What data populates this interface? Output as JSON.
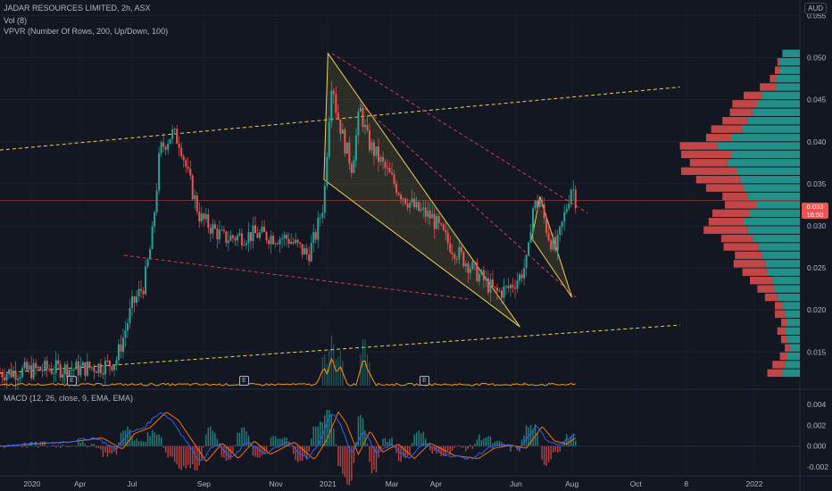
{
  "header": {
    "title": "JADAR RESOURCES LIMITED, 2h, ASX",
    "vol_label": "Vol (8)",
    "vpvr_label": "VPVR (Number Of Rows, 200, Up/Down, 100)",
    "currency": "AUD"
  },
  "macd": {
    "label": "MACD (12, 26, close, 9, EMA, EMA)"
  },
  "last_price": {
    "value": "0.033",
    "countdown": "16:50",
    "color": "#ef5350"
  },
  "events": [
    "E",
    "E",
    "E"
  ],
  "colors": {
    "up": "#26a69a",
    "down": "#ef5350",
    "macd": "#2962ff",
    "signal": "#ff6d00",
    "trend_yellow": "#f0d050",
    "trend_red": "#d04050",
    "volume_line": "#ff9800"
  },
  "chart_data": {
    "type": "candlestick",
    "title": "JADAR RESOURCES LIMITED, 2h, ASX",
    "y_axis": {
      "ylim": [
        0.011,
        0.056
      ],
      "ticks": [
        "0.055",
        "0.050",
        "0.045",
        "0.040",
        "0.035",
        "0.030",
        "0.025",
        "0.020",
        "0.015"
      ]
    },
    "x_axis": {
      "ticks": [
        "2020",
        "Apr",
        "Jul",
        "Sep",
        "Nov",
        "2021",
        "Mar",
        "Apr",
        "Jun",
        "Aug",
        "Oct",
        "8",
        "2022"
      ]
    },
    "price_path": [
      [
        0,
        0.0125
      ],
      [
        0.06,
        0.013
      ],
      [
        0.1,
        0.013
      ],
      [
        0.135,
        0.0135
      ],
      [
        0.145,
        0.014
      ],
      [
        0.155,
        0.017
      ],
      [
        0.165,
        0.0205
      ],
      [
        0.18,
        0.023
      ],
      [
        0.19,
        0.0285
      ],
      [
        0.2,
        0.039
      ],
      [
        0.215,
        0.041
      ],
      [
        0.225,
        0.04
      ],
      [
        0.235,
        0.036
      ],
      [
        0.25,
        0.031
      ],
      [
        0.28,
        0.0285
      ],
      [
        0.32,
        0.029
      ],
      [
        0.36,
        0.0285
      ],
      [
        0.385,
        0.0265
      ],
      [
        0.395,
        0.029
      ],
      [
        0.405,
        0.033
      ],
      [
        0.41,
        0.041
      ],
      [
        0.415,
        0.048
      ],
      [
        0.42,
        0.044
      ],
      [
        0.43,
        0.04
      ],
      [
        0.44,
        0.037
      ],
      [
        0.45,
        0.044
      ],
      [
        0.46,
        0.04
      ],
      [
        0.48,
        0.037
      ],
      [
        0.5,
        0.034
      ],
      [
        0.52,
        0.032
      ],
      [
        0.54,
        0.031
      ],
      [
        0.56,
        0.028
      ],
      [
        0.58,
        0.026
      ],
      [
        0.6,
        0.024
      ],
      [
        0.62,
        0.022
      ],
      [
        0.635,
        0.0225
      ],
      [
        0.65,
        0.024
      ],
      [
        0.66,
        0.026
      ],
      [
        0.665,
        0.032
      ],
      [
        0.675,
        0.033
      ],
      [
        0.685,
        0.029
      ],
      [
        0.695,
        0.027
      ],
      [
        0.705,
        0.031
      ],
      [
        0.71,
        0.033
      ],
      [
        0.715,
        0.035
      ],
      [
        0.72,
        0.033
      ]
    ],
    "last_value": 0.033,
    "trendlines": [
      {
        "color": "#f0d050",
        "dash": true,
        "points": [
          [
            0,
            0.039
          ],
          [
            0.85,
            0.0465
          ]
        ]
      },
      {
        "color": "#f0d050",
        "dash": true,
        "points": [
          [
            0,
            0.0125
          ],
          [
            0.85,
            0.0182
          ]
        ]
      },
      {
        "color": "#d04050",
        "dash": true,
        "points": [
          [
            0.155,
            0.0265
          ],
          [
            0.585,
            0.0213
          ]
        ]
      },
      {
        "color": "#d04050",
        "dash": true,
        "points": [
          [
            0.415,
            0.0505
          ],
          [
            0.735,
            0.0315
          ]
        ]
      },
      {
        "color": "#d04050",
        "dash": true,
        "points": [
          [
            0.45,
            0.0445
          ],
          [
            0.72,
            0.0215
          ]
        ]
      }
    ],
    "wedges": [
      {
        "points": [
          [
            0.405,
            0.0355
          ],
          [
            0.41,
            0.0505
          ],
          [
            0.65,
            0.018
          ]
        ]
      },
      {
        "points": [
          [
            0.665,
            0.0285
          ],
          [
            0.675,
            0.0335
          ],
          [
            0.715,
            0.0215
          ]
        ]
      }
    ],
    "horizontal_line": {
      "value": 0.033,
      "color": "#ef5350"
    },
    "volume_profile": {
      "rows": [
        [
          0.0505,
          0.14,
          0.0
        ],
        [
          0.0495,
          0.16,
          0.02
        ],
        [
          0.0485,
          0.16,
          0.04
        ],
        [
          0.0475,
          0.19,
          0.05
        ],
        [
          0.0465,
          0.19,
          0.13
        ],
        [
          0.0455,
          0.3,
          0.15
        ],
        [
          0.0445,
          0.34,
          0.2
        ],
        [
          0.0435,
          0.38,
          0.18
        ],
        [
          0.0425,
          0.42,
          0.2
        ],
        [
          0.0415,
          0.46,
          0.25
        ],
        [
          0.0405,
          0.55,
          0.2
        ],
        [
          0.0395,
          0.66,
          0.3
        ],
        [
          0.0385,
          0.55,
          0.4
        ],
        [
          0.0375,
          0.58,
          0.3
        ],
        [
          0.0365,
          0.5,
          0.45
        ],
        [
          0.0355,
          0.48,
          0.35
        ],
        [
          0.0345,
          0.45,
          0.3
        ],
        [
          0.0335,
          0.42,
          0.2
        ],
        [
          0.0325,
          0.35,
          0.25
        ],
        [
          0.0315,
          0.4,
          0.3
        ],
        [
          0.0305,
          0.45,
          0.28
        ],
        [
          0.0295,
          0.42,
          0.35
        ],
        [
          0.0285,
          0.38,
          0.25
        ],
        [
          0.0275,
          0.33,
          0.28
        ],
        [
          0.0265,
          0.3,
          0.22
        ],
        [
          0.0255,
          0.28,
          0.25
        ],
        [
          0.0245,
          0.26,
          0.2
        ],
        [
          0.0235,
          0.22,
          0.18
        ],
        [
          0.0225,
          0.2,
          0.14
        ],
        [
          0.0215,
          0.18,
          0.1
        ],
        [
          0.0205,
          0.14,
          0.06
        ],
        [
          0.0195,
          0.12,
          0.08
        ],
        [
          0.0185,
          0.1,
          0.05
        ],
        [
          0.0175,
          0.12,
          0.06
        ],
        [
          0.0165,
          0.1,
          0.05
        ],
        [
          0.0155,
          0.08,
          0.04
        ],
        [
          0.0145,
          0.1,
          0.06
        ],
        [
          0.0135,
          0.12,
          0.1
        ],
        [
          0.0125,
          0.14,
          0.12
        ]
      ]
    },
    "volume_spikes": [
      [
        0.405,
        0.65
      ],
      [
        0.415,
        1.0
      ],
      [
        0.425,
        0.7
      ],
      [
        0.455,
        1.0
      ],
      [
        0.46,
        0.55
      ]
    ],
    "macd": {
      "ylim": [
        -0.0026,
        0.0041
      ],
      "ticks": [
        "0.004",
        "0.002",
        "0.000",
        "-0.002"
      ],
      "path": [
        [
          0,
          0.0
        ],
        [
          0.03,
          0.0002
        ],
        [
          0.08,
          0.0004
        ],
        [
          0.12,
          0.0008
        ],
        [
          0.145,
          -0.0003
        ],
        [
          0.16,
          0.0012
        ],
        [
          0.18,
          0.0018
        ],
        [
          0.2,
          0.0033
        ],
        [
          0.215,
          0.0025
        ],
        [
          0.23,
          0.0008
        ],
        [
          0.25,
          -0.0015
        ],
        [
          0.27,
          0.0003
        ],
        [
          0.29,
          -0.0012
        ],
        [
          0.31,
          0.0005
        ],
        [
          0.33,
          -0.0008
        ],
        [
          0.36,
          0.0004
        ],
        [
          0.385,
          -0.0013
        ],
        [
          0.4,
          0.0005
        ],
        [
          0.415,
          0.0033
        ],
        [
          0.425,
          0.0022
        ],
        [
          0.44,
          -0.0008
        ],
        [
          0.455,
          0.0015
        ],
        [
          0.47,
          -0.0006
        ],
        [
          0.49,
          0.0002
        ],
        [
          0.51,
          -0.0012
        ],
        [
          0.53,
          0.0003
        ],
        [
          0.56,
          -0.0009
        ],
        [
          0.59,
          -0.0012
        ],
        [
          0.61,
          -0.0002
        ],
        [
          0.63,
          0.0001
        ],
        [
          0.65,
          -0.0002
        ],
        [
          0.67,
          0.0019
        ],
        [
          0.685,
          0.0005
        ],
        [
          0.7,
          0.0002
        ],
        [
          0.72,
          0.0012
        ]
      ]
    }
  }
}
